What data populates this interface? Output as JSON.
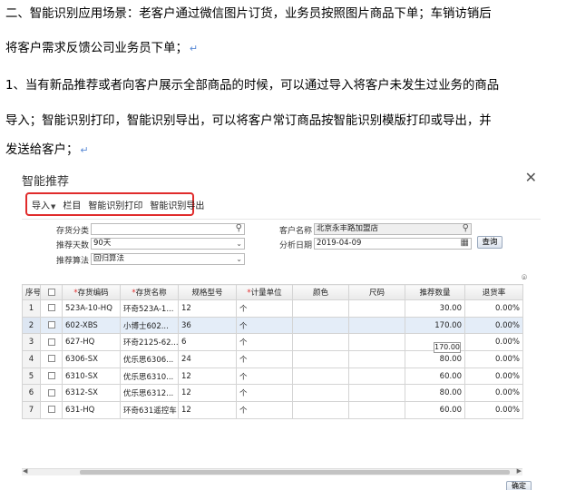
{
  "doc": {
    "p1": "二、智能识别应用场景：老客户通过微信图片订货，业务员按照图片商品下单；车销访销后",
    "p2": "将客户需求反馈公司业务员下单；",
    "p3": "1、当有新品推荐或者向客户展示全部商品的时候，可以通过导入将客户未发生过业务的商品",
    "p4": "导入；智能识别打印，智能识别导出，可以将客户常订商品按智能识别模版打印或导出，并",
    "p5": "发送给客户；",
    "para_mark": "↵"
  },
  "window": {
    "title": "智能推荐",
    "close_glyph": "✕"
  },
  "toolbar": {
    "import_label": "导入",
    "import_caret": "▼",
    "columns_label": "栏目",
    "smart_print_label": "智能识别打印",
    "smart_export_label": "智能识别导出"
  },
  "form": {
    "inventory_class_label": "存货分类",
    "inventory_class_value": "",
    "recommend_days_label": "推荐天数",
    "recommend_days_value": "90天",
    "recommend_algo_label": "推荐算法",
    "recommend_algo_value": "回归算法",
    "customer_name_label": "客户名称",
    "customer_name_value": "北京永丰路加盟店",
    "analysis_date_label": "分析日期",
    "analysis_date_value": "2019-04-09",
    "query_button": "查询",
    "search_glyph": "⚲",
    "chevron_glyph": "⌄",
    "calendar_glyph": "▦"
  },
  "location_glyph": "⌾",
  "table": {
    "headers": {
      "seq": "序号",
      "code": "存货编码",
      "name": "存货名称",
      "spec": "规格型号",
      "unit": "计量单位",
      "color": "颜色",
      "size": "尺码",
      "qty": "推荐数量",
      "return_rate": "退货率",
      "req_mark": "*"
    },
    "rows": [
      {
        "seq": "1",
        "code": "523A-10-HQ",
        "name": "环奇523A-1...",
        "spec": "12",
        "unit": "个",
        "color": "",
        "size": "",
        "qty": "30.00",
        "rate": "0.00%"
      },
      {
        "seq": "2",
        "code": "602-XBS",
        "name": "小博士602...",
        "spec": "36",
        "unit": "个",
        "color": "",
        "size": "",
        "qty": "170.00",
        "rate": "0.00%"
      },
      {
        "seq": "3",
        "code": "627-HQ",
        "name": "环奇2125-62...",
        "spec": "6",
        "unit": "个",
        "color": "",
        "size": "",
        "qty": "",
        "rate": "0.00%"
      },
      {
        "seq": "4",
        "code": "6306-SX",
        "name": "优乐思6306...",
        "spec": "24",
        "unit": "个",
        "color": "",
        "size": "",
        "qty": "80.00",
        "rate": "0.00%"
      },
      {
        "seq": "5",
        "code": "6310-SX",
        "name": "优乐思6310...",
        "spec": "12",
        "unit": "个",
        "color": "",
        "size": "",
        "qty": "60.00",
        "rate": "0.00%"
      },
      {
        "seq": "6",
        "code": "6312-SX",
        "name": "优乐思6312...",
        "spec": "12",
        "unit": "个",
        "color": "",
        "size": "",
        "qty": "80.00",
        "rate": "0.00%"
      },
      {
        "seq": "7",
        "code": "631-HQ",
        "name": "环奇631遥控车",
        "spec": "12",
        "unit": "个",
        "color": "",
        "size": "",
        "qty": "60.00",
        "rate": "0.00%"
      }
    ],
    "tooltip": "170.00"
  },
  "scroll": {
    "left_glyph": "◀",
    "right_glyph": "▶"
  },
  "ok_button": "确定"
}
